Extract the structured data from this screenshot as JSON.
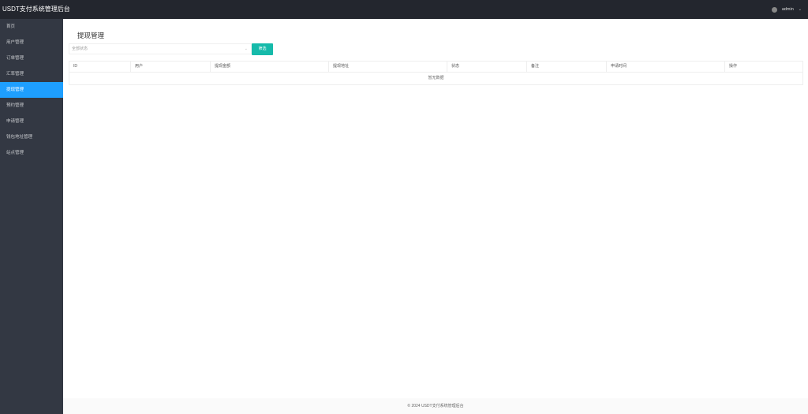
{
  "app": {
    "title": "USDT支付系统管理后台"
  },
  "header": {
    "user": "admin"
  },
  "sidebar": {
    "items": [
      {
        "label": "首页"
      },
      {
        "label": "用户管理"
      },
      {
        "label": "订单管理"
      },
      {
        "label": "汇率管理"
      },
      {
        "label": "提现管理"
      },
      {
        "label": "预约管理"
      },
      {
        "label": "申请管理"
      },
      {
        "label": "钱包地址管理"
      },
      {
        "label": "站点管理"
      }
    ]
  },
  "page": {
    "title": "提现管理",
    "filter": {
      "status_value": "全部状态",
      "button_label": "筛选"
    },
    "table": {
      "columns": [
        "ID",
        "用户",
        "提现金额",
        "提现地址",
        "状态",
        "备注",
        "申请时间",
        "操作"
      ],
      "empty_text": "暂无数据"
    }
  },
  "footer": {
    "text": "© 2024 USDT支付系统管理后台"
  },
  "colors": {
    "topbar": "#23262e",
    "sidebar": "#333843",
    "active": "#1e9fff",
    "button": "#16baaa"
  }
}
